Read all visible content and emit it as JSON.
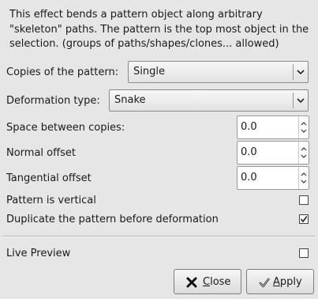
{
  "description": "This effect bends a pattern object along arbitrary \"skeleton\" paths. The pattern is the top most object in the selection. (groups of paths/shapes/clones... allowed)",
  "copies": {
    "label": "Copies of the pattern:",
    "value": "Single"
  },
  "deformation": {
    "label": "Deformation type:",
    "value": "Snake"
  },
  "space": {
    "label": "Space between copies:",
    "value": "0.0"
  },
  "normal_offset": {
    "label": "Normal offset",
    "value": "0.0"
  },
  "tangential_offset": {
    "label": "Tangential offset",
    "value": "0.0"
  },
  "pattern_vertical": {
    "label": "Pattern is vertical",
    "checked": false
  },
  "duplicate": {
    "label": "Duplicate the pattern before deformation",
    "checked": true
  },
  "live_preview": {
    "label": "Live Preview",
    "checked": false
  },
  "buttons": {
    "close": {
      "first": "C",
      "rest": "lose",
      "icon": "close-x-icon"
    },
    "apply": {
      "first": "A",
      "rest": "pply",
      "icon": "checkmark-icon"
    }
  }
}
